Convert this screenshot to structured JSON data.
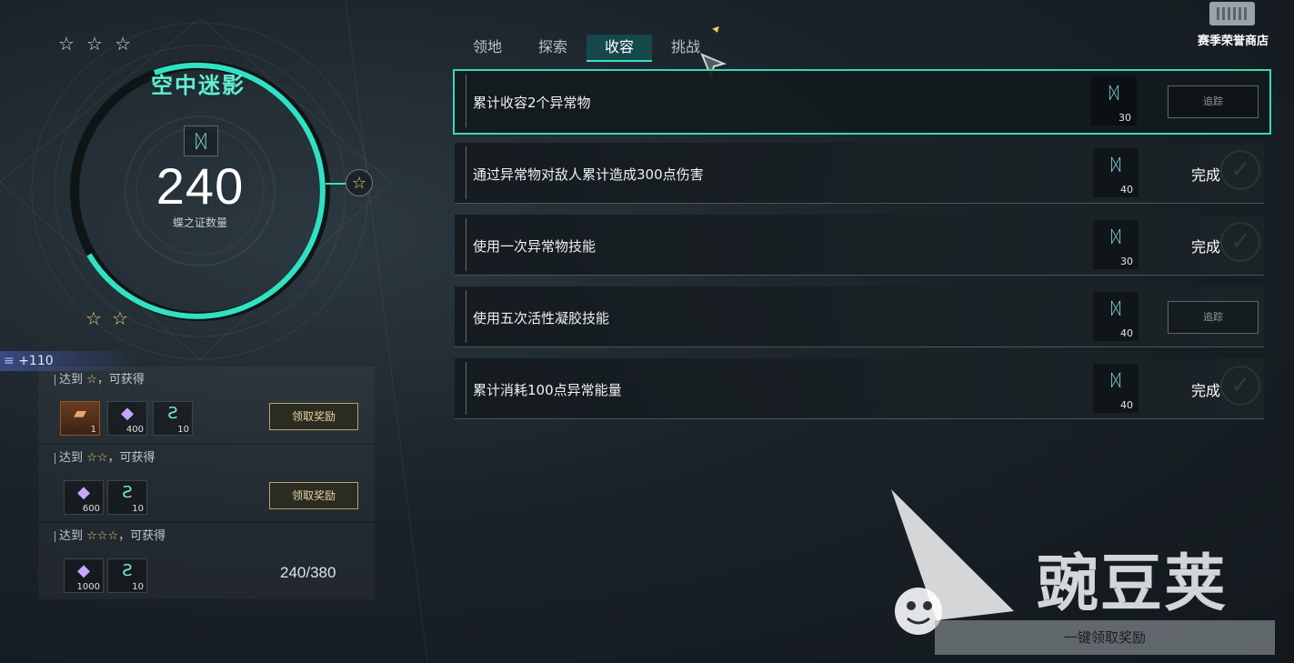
{
  "left_panel": {
    "top_stars": [
      "☆",
      "☆",
      "☆"
    ],
    "boss_name": "空中迷影",
    "emblem_icon": "butterfly-icon",
    "count": "240",
    "count_label": "蝶之证数量",
    "side_star": "☆",
    "bottom_stars": [
      "☆",
      "☆"
    ],
    "bonus": "+110",
    "tiers": [
      {
        "prefix": "达到",
        "stars": "☆",
        "suffix": "，可获得",
        "items": [
          {
            "icon": "orange-item-icon",
            "count": "1"
          },
          {
            "icon": "crystal-icon",
            "count": "400"
          },
          {
            "icon": "dna-icon",
            "count": "10"
          }
        ],
        "button": "领取奖励"
      },
      {
        "prefix": "达到",
        "stars": "☆☆",
        "suffix": "，可获得",
        "items": [
          {
            "icon": "crystal-icon",
            "count": "600"
          },
          {
            "icon": "dna-icon",
            "count": "10"
          }
        ],
        "button": "领取奖励"
      },
      {
        "prefix": "达到",
        "stars": "☆☆☆",
        "suffix": "，可获得",
        "items": [
          {
            "icon": "crystal-icon",
            "count": "1000"
          },
          {
            "icon": "dna-icon",
            "count": "10"
          }
        ],
        "progress": "240/380"
      }
    ]
  },
  "tabs": [
    {
      "label": "领地",
      "active": false
    },
    {
      "label": "探索",
      "active": false
    },
    {
      "label": "收容",
      "active": true
    },
    {
      "label": "挑战",
      "active": false
    }
  ],
  "store": {
    "label": "赛季荣誉商店",
    "icon": "store-icon"
  },
  "tasks": [
    {
      "text": "累计收容2个异常物",
      "reward": "30",
      "status": "track",
      "status_label": "追踪",
      "selected": true
    },
    {
      "text": "通过异常物对敌人累计造成300点伤害",
      "reward": "40",
      "status": "done",
      "status_label": "完成",
      "selected": false
    },
    {
      "text": "使用一次异常物技能",
      "reward": "30",
      "status": "done",
      "status_label": "完成",
      "selected": false
    },
    {
      "text": "使用五次活性凝胶技能",
      "reward": "40",
      "status": "track",
      "status_label": "追踪",
      "selected": false
    },
    {
      "text": "累计消耗100点异常能量",
      "reward": "40",
      "status": "done",
      "status_label": "完成",
      "selected": false
    }
  ],
  "watermark": {
    "text": "豌豆荚"
  },
  "claim_all": "一键领取奖励",
  "colors": {
    "accent": "#3fe0c2",
    "gold": "#e8c877",
    "selected_border": "#37d9b8"
  }
}
